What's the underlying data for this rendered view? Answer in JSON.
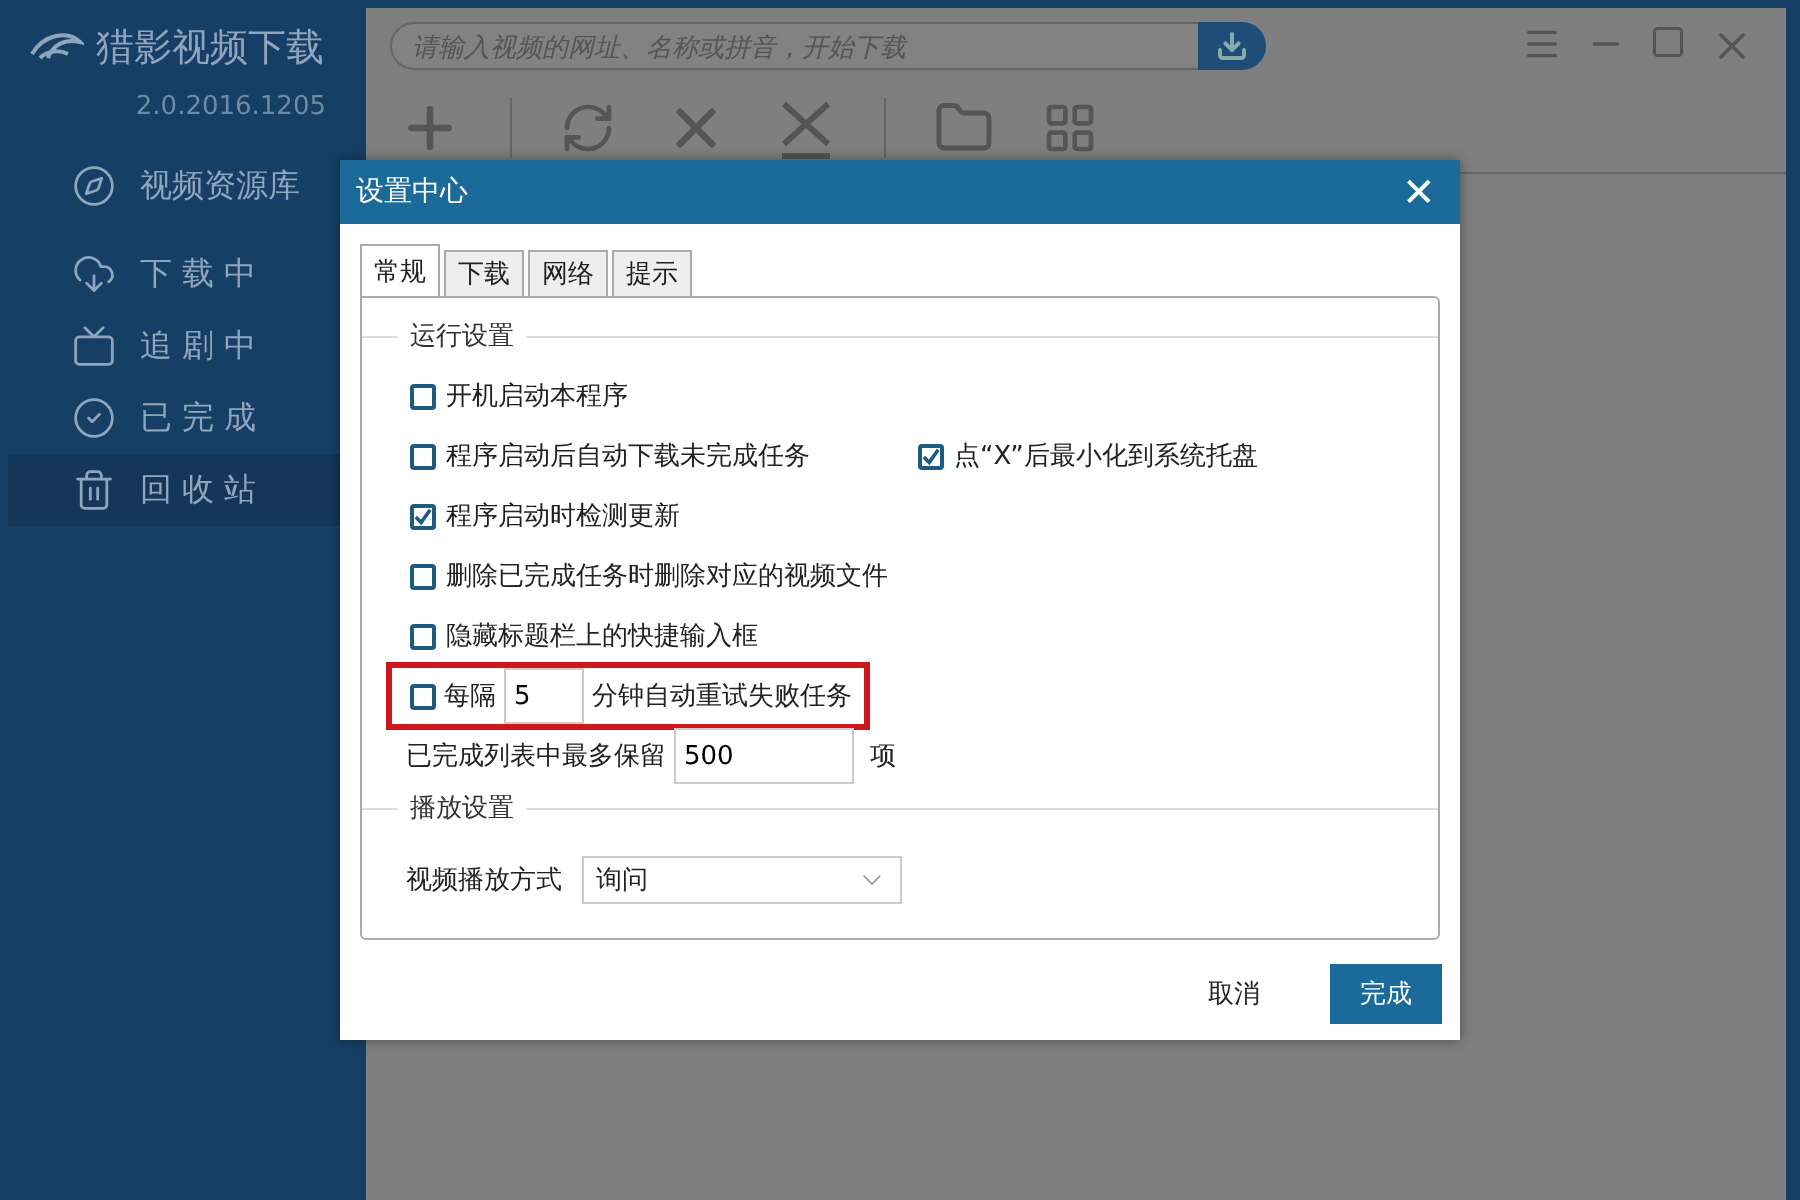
{
  "app": {
    "title": "猎影视频下载",
    "version": "2.0.2016.1205",
    "search": {
      "placeholder": "请输入视频的网址、名称或拼音，开始下载"
    }
  },
  "sidebar": {
    "items": [
      {
        "label": "视频资源库",
        "kind": "library",
        "selected": false
      },
      {
        "label": "下 载 中",
        "kind": "downloading",
        "selected": false
      },
      {
        "label": "追 剧 中",
        "kind": "series",
        "selected": false
      },
      {
        "label": "已 完 成",
        "kind": "done",
        "selected": false
      },
      {
        "label": "回 收 站",
        "kind": "trash",
        "selected": true
      }
    ]
  },
  "dialog": {
    "title": "设置中心",
    "close": "✕",
    "tabs": [
      {
        "label": "常规",
        "selected": true
      },
      {
        "label": "下载",
        "selected": false
      },
      {
        "label": "网络",
        "selected": false
      },
      {
        "label": "提示",
        "selected": false
      }
    ],
    "sections": [
      {
        "title": "运行设置",
        "rows": [
          {
            "kind": "checks",
            "items": [
              {
                "label": "开机启动本程序",
                "checked": false
              }
            ]
          },
          {
            "kind": "checks",
            "items": [
              {
                "label": "程序启动后自动下载未完成任务",
                "checked": false
              },
              {
                "label": "点“X”后最小化到系统托盘",
                "checked": true
              }
            ]
          },
          {
            "kind": "checks",
            "items": [
              {
                "label": "程序启动时检测更新",
                "checked": true
              }
            ]
          },
          {
            "kind": "checks",
            "items": [
              {
                "label": "删除已完成任务时删除对应的视频文件",
                "checked": false
              }
            ]
          },
          {
            "kind": "checks",
            "items": [
              {
                "label": "隐藏标题栏上的快捷输入框",
                "checked": false
              }
            ]
          },
          {
            "kind": "interval",
            "checked": false,
            "highlighted": true,
            "prefix": "每隔",
            "value": "5",
            "suffix": "分钟自动重试失败任务"
          },
          {
            "kind": "number",
            "label": "已完成列表中最多保留",
            "value": "500",
            "suffix": "项"
          }
        ]
      },
      {
        "title": "播放设置",
        "rows": [
          {
            "kind": "select",
            "label": "视频播放方式",
            "value": "询问"
          }
        ]
      }
    ],
    "buttons": [
      {
        "label": "取消",
        "primary": false
      },
      {
        "label": "完成",
        "primary": true
      }
    ]
  }
}
